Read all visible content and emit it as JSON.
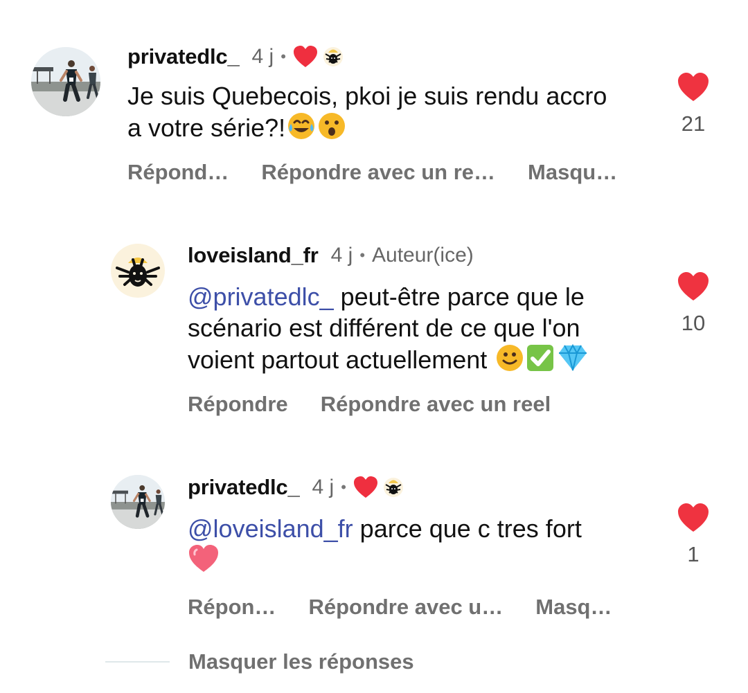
{
  "comments": [
    {
      "username": "privatedlc_",
      "time": "4 j",
      "dot": "•",
      "text": "Je suis Quebecois, pkoi je suis rendu accro a votre série?!",
      "actions": [
        "Répond…",
        "Répondre avec un re…",
        "Masqu…"
      ],
      "likes": "21"
    },
    {
      "username": "loveisland_fr",
      "time": "4 j",
      "dot": "•",
      "author_label": "Auteur(ice)",
      "mention": "@privatedlc_",
      "text": " peut-être parce que le scénario est différent de ce que l'on voient partout actuellement ",
      "actions": [
        "Répondre",
        "Répondre avec un reel"
      ],
      "likes": "10"
    },
    {
      "username": "privatedlc_",
      "time": "4 j",
      "dot": "•",
      "mention": "@loveisland_fr",
      "text": " parce que c tres fort",
      "actions": [
        "Répon…",
        "Répondre avec u…",
        "Masq…"
      ],
      "likes": "1"
    }
  ],
  "footer": {
    "hide_replies": "Masquer les réponses"
  },
  "icons": {
    "like": "heart-icon",
    "creator_like": "red-heart-icon",
    "brand": "lion-logo-icon",
    "emoji_laughing": "laughing-emoji-icon",
    "emoji_surprised": "surprised-emoji-icon",
    "emoji_smile": "smile-emoji-icon",
    "emoji_check": "check-emoji-icon",
    "emoji_diamond": "diamond-emoji-icon",
    "emoji_heart": "heart-emoji-icon"
  },
  "colors": {
    "like_red": "#ef3340",
    "mention_blue": "#3d4fa8",
    "muted_text": "#707070",
    "brand_background": "#fbf2dd"
  }
}
